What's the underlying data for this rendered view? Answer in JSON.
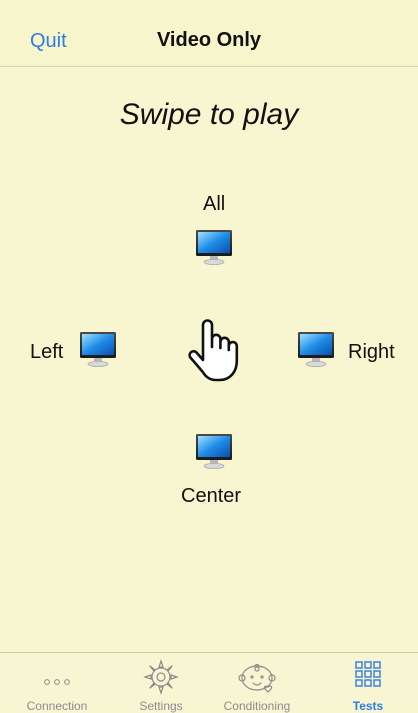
{
  "navbar": {
    "quit_label": "Quit",
    "title": "Video Only"
  },
  "main": {
    "instruction": "Swipe to play",
    "targets": {
      "all": "All",
      "left": "Left",
      "right": "Right",
      "center": "Center"
    },
    "monitor_icon": "monitor-icon",
    "hand_icon": "hand-pointer-icon"
  },
  "tabbar": {
    "tabs": [
      {
        "label": "Connection",
        "icon": "ellipsis-icon",
        "active": false
      },
      {
        "label": "Settings",
        "icon": "gear-icon",
        "active": false
      },
      {
        "label": "Conditioning",
        "icon": "baby-face-icon",
        "active": false
      },
      {
        "label": "Tests",
        "icon": "grid-icon",
        "active": true
      }
    ]
  },
  "colors": {
    "accent": "#2f7ce0",
    "background": "#f8f6d0",
    "inactive": "#8c8c8c"
  }
}
